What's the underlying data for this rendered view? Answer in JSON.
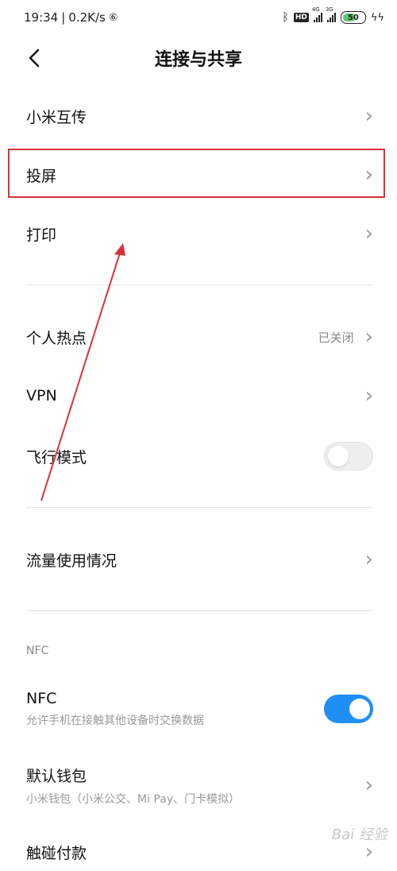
{
  "status": {
    "time": "19:34",
    "speed": "0.2K/s",
    "hd": "HD",
    "sig1": "4G",
    "sig2": "3G",
    "battery": "50"
  },
  "header": {
    "title": "连接与共享"
  },
  "items": {
    "mi_transfer": "小米互传",
    "cast": "投屏",
    "print": "打印",
    "hotspot": "个人热点",
    "hotspot_value": "已关闭",
    "vpn": "VPN",
    "airplane": "飞行模式",
    "data_usage": "流量使用情况",
    "nfc_section": "NFC",
    "nfc": "NFC",
    "nfc_sub": "允许手机在接触其他设备时交换数据",
    "wallet": "默认钱包",
    "wallet_sub": "小米钱包（小米公交、Mi Pay、门卡模拟）",
    "tap_pay": "触碰付款"
  },
  "toggles": {
    "airplane_on": false,
    "nfc_on": true
  },
  "colors": {
    "accent": "#1f8ff5",
    "annotation": "#d8323a"
  },
  "watermark": "Bai 经验"
}
